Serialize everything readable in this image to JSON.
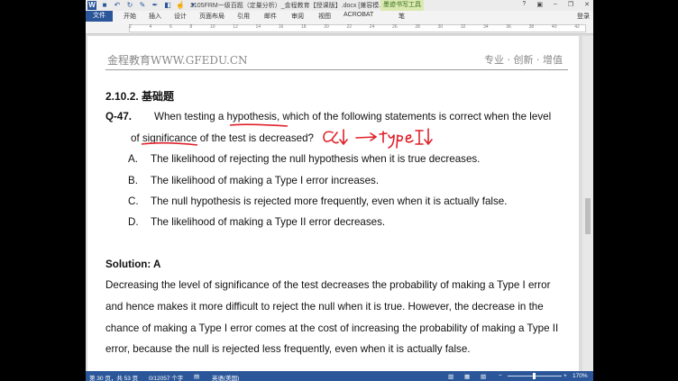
{
  "window": {
    "title": "2105FRM一级百题（定量分析）_金程教育【授课版】.docx [兼容模...",
    "context_tab": "墨迹书写工具",
    "login": "登录",
    "word_icon": "W"
  },
  "ribbon_tabs": [
    "文件",
    "开始",
    "插入",
    "设计",
    "页面布局",
    "引用",
    "邮件",
    "审阅",
    "视图",
    "ACROBAT",
    "笔"
  ],
  "ruler_numbers": [
    "2",
    "4",
    "6",
    "8",
    "10",
    "12",
    "14",
    "16",
    "18",
    "20",
    "22",
    "24",
    "26",
    "28",
    "30",
    "32",
    "34",
    "36",
    "38",
    "40",
    "42"
  ],
  "page": {
    "header_left": "金程教育WWW.GFEDU.CN",
    "header_right": "专业 · 创新 · 增值",
    "section": "2.10.2.  基础题",
    "question_number": "Q-47.",
    "question_line1": "When testing a hypothesis, which of the following statements is correct when the level",
    "question_line2": "of significance of the test is decreased?",
    "options": [
      {
        "letter": "A.",
        "text": "The likelihood of rejecting the null hypothesis when it is true decreases."
      },
      {
        "letter": "B.",
        "text": "The likelihood of making a Type I error increases."
      },
      {
        "letter": "C.",
        "text": "The null hypothesis is rejected more frequently, even when it is actually false."
      },
      {
        "letter": "D.",
        "text": "The likelihood of making a Type II error decreases."
      }
    ],
    "solution_title": "Solution: A",
    "solution_lines": [
      "Decreasing the level of significance of the test decreases the probability of making a Type I error",
      "and hence makes it more difficult to reject the null when it is true. However, the decrease in the",
      "chance of making a Type I error comes at the cost of increasing the probability of making a Type II",
      "error, because the null is rejected less frequently, even when it is actually false."
    ],
    "annotation": {
      "ink_color": "#e0202a",
      "text": "α↓ → typeⅠ↓"
    }
  },
  "status": {
    "page": "第 30 页，共 53 页",
    "words": "0/12057 个字",
    "language": "英语(美国)",
    "zoom": "170%"
  }
}
